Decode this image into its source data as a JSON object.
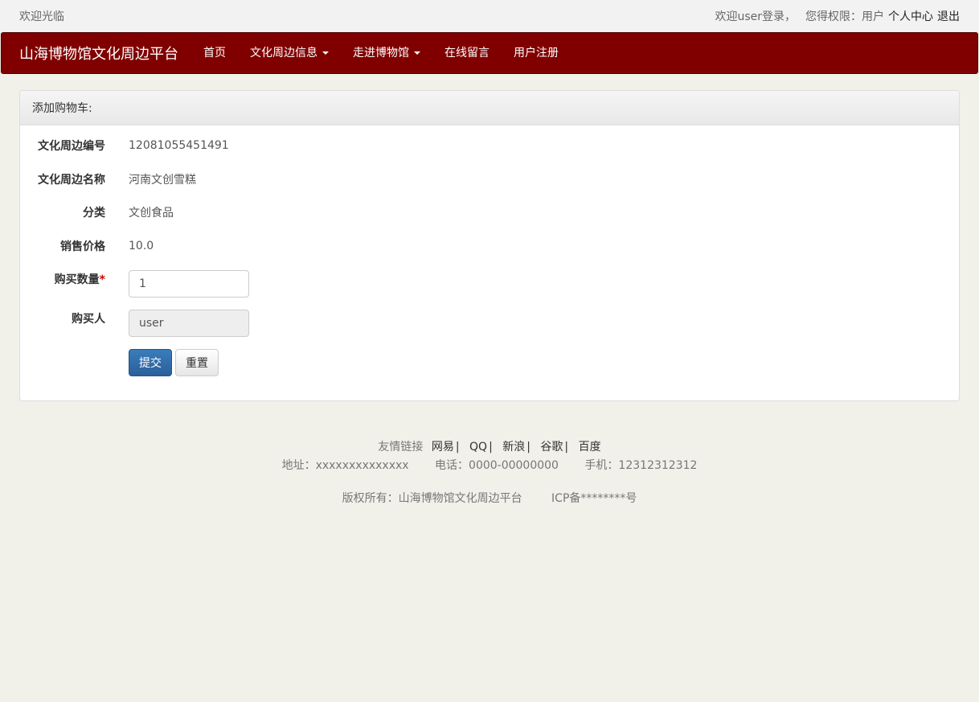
{
  "topbar": {
    "welcome": "欢迎光临",
    "login_text": "欢迎user登录，",
    "permission_text": "您得权限：用户",
    "personal_center": "个人中心",
    "logout": "退出"
  },
  "navbar": {
    "brand": "山海博物馆文化周边平台",
    "items": [
      {
        "label": "首页",
        "dropdown": false
      },
      {
        "label": "文化周边信息",
        "dropdown": true
      },
      {
        "label": "走进博物馆",
        "dropdown": true
      },
      {
        "label": "在线留言",
        "dropdown": false
      },
      {
        "label": "用户注册",
        "dropdown": false
      }
    ]
  },
  "form": {
    "heading": "添加购物车:",
    "fields": {
      "code_label": "文化周边编号",
      "code_value": "12081055451491",
      "name_label": "文化周边名称",
      "name_value": "河南文创雪糕",
      "category_label": "分类",
      "category_value": "文创食品",
      "price_label": "销售价格",
      "price_value": "10.0",
      "quantity_label": "购买数量",
      "quantity_required": "*",
      "quantity_value": "1",
      "buyer_label": "购买人",
      "buyer_value": "user"
    },
    "submit_label": "提交",
    "reset_label": "重置"
  },
  "footer": {
    "links_label": "友情链接",
    "links": [
      "网易",
      "QQ",
      "新浪",
      "谷歌",
      "百度"
    ],
    "link_separator": "|",
    "address": "地址：xxxxxxxxxxxxxx",
    "phone": "电话：0000-00000000",
    "mobile": "手机：12312312312",
    "copyright": "版权所有：山海博物馆文化周边平台",
    "icp": "ICP备********号"
  },
  "colors": {
    "navbar_bg": "#800000",
    "page_bg": "#f1f0e9",
    "primary_button": "#2a609a"
  }
}
